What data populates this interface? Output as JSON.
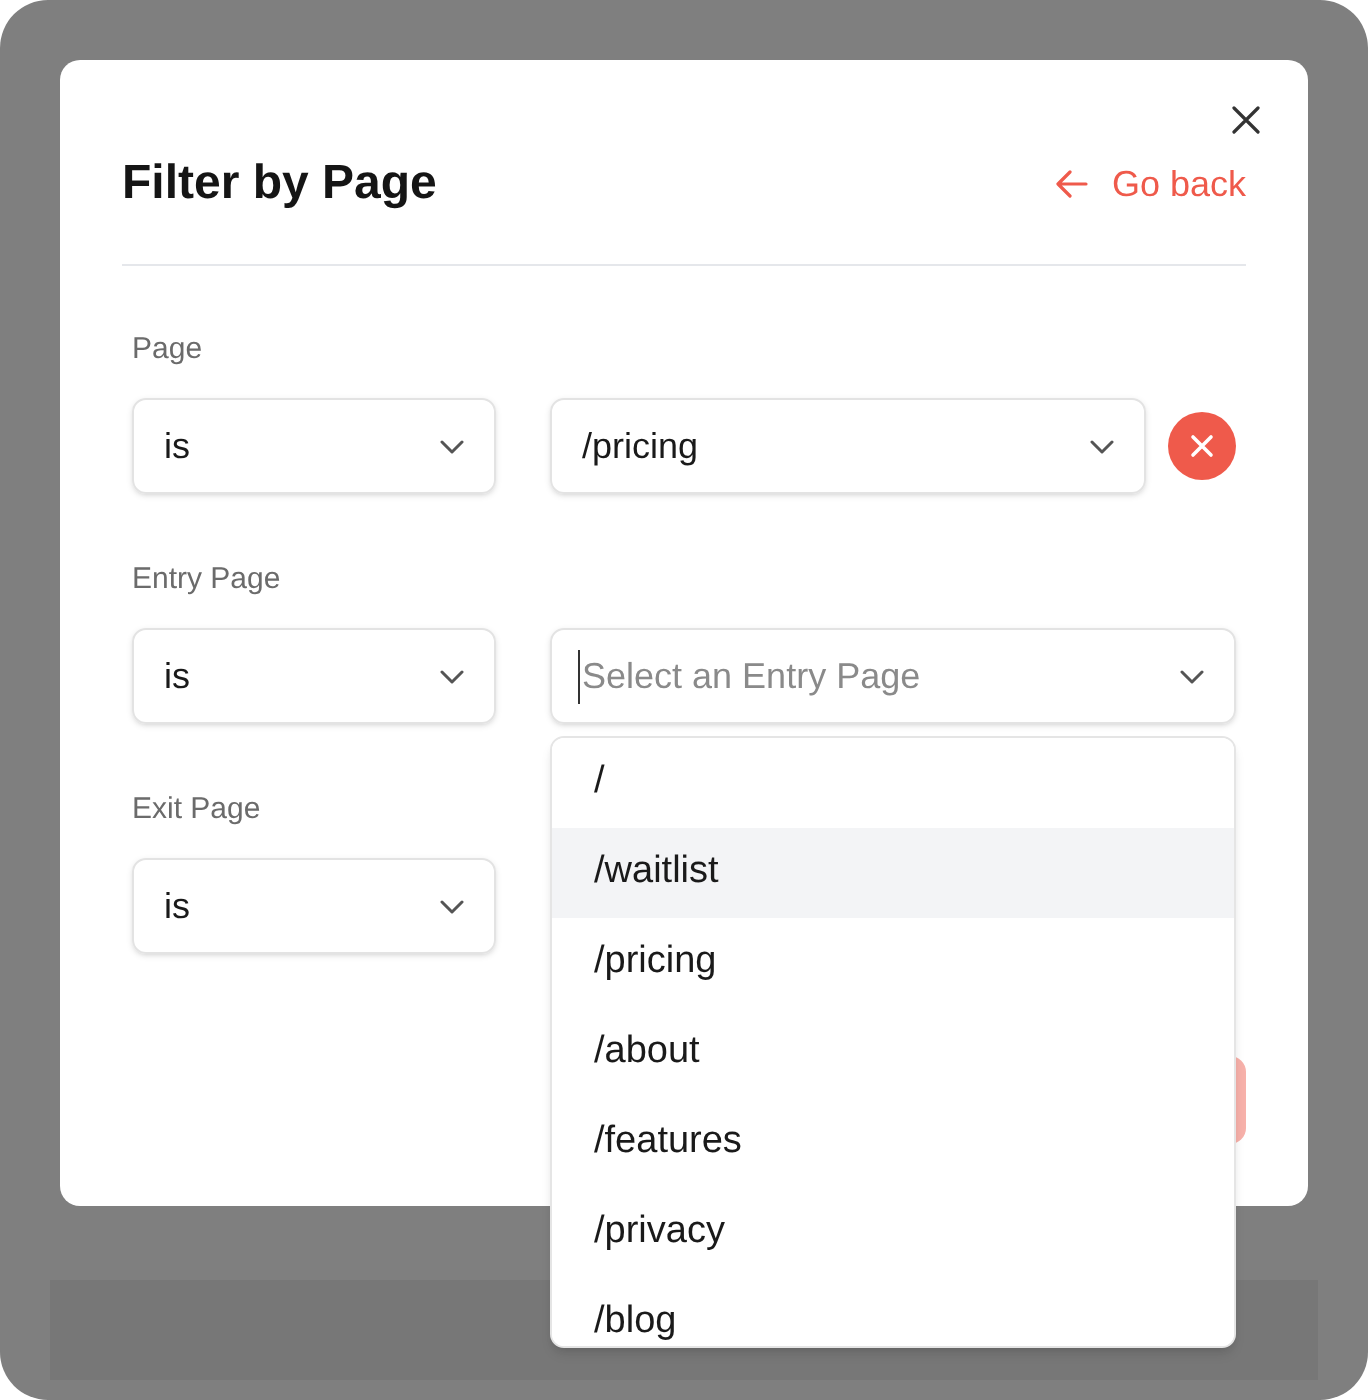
{
  "dialog": {
    "title": "Filter by Page",
    "back_link": "Go back"
  },
  "filters": [
    {
      "label": "Page",
      "operator": "is",
      "value": "/pricing",
      "removable": true
    },
    {
      "label": "Entry Page",
      "operator": "is",
      "placeholder": "Select an Entry Page",
      "focused": true,
      "dropdown": [
        {
          "label": "/",
          "selected": false
        },
        {
          "label": "/waitlist",
          "selected": true
        },
        {
          "label": "/pricing",
          "selected": false
        },
        {
          "label": "/about",
          "selected": false
        },
        {
          "label": "/features",
          "selected": false
        },
        {
          "label": "/privacy",
          "selected": false
        },
        {
          "label": "/blog",
          "selected": false
        }
      ]
    },
    {
      "label": "Exit Page",
      "operator": "is"
    }
  ],
  "submit_button": {
    "disabled": true
  }
}
